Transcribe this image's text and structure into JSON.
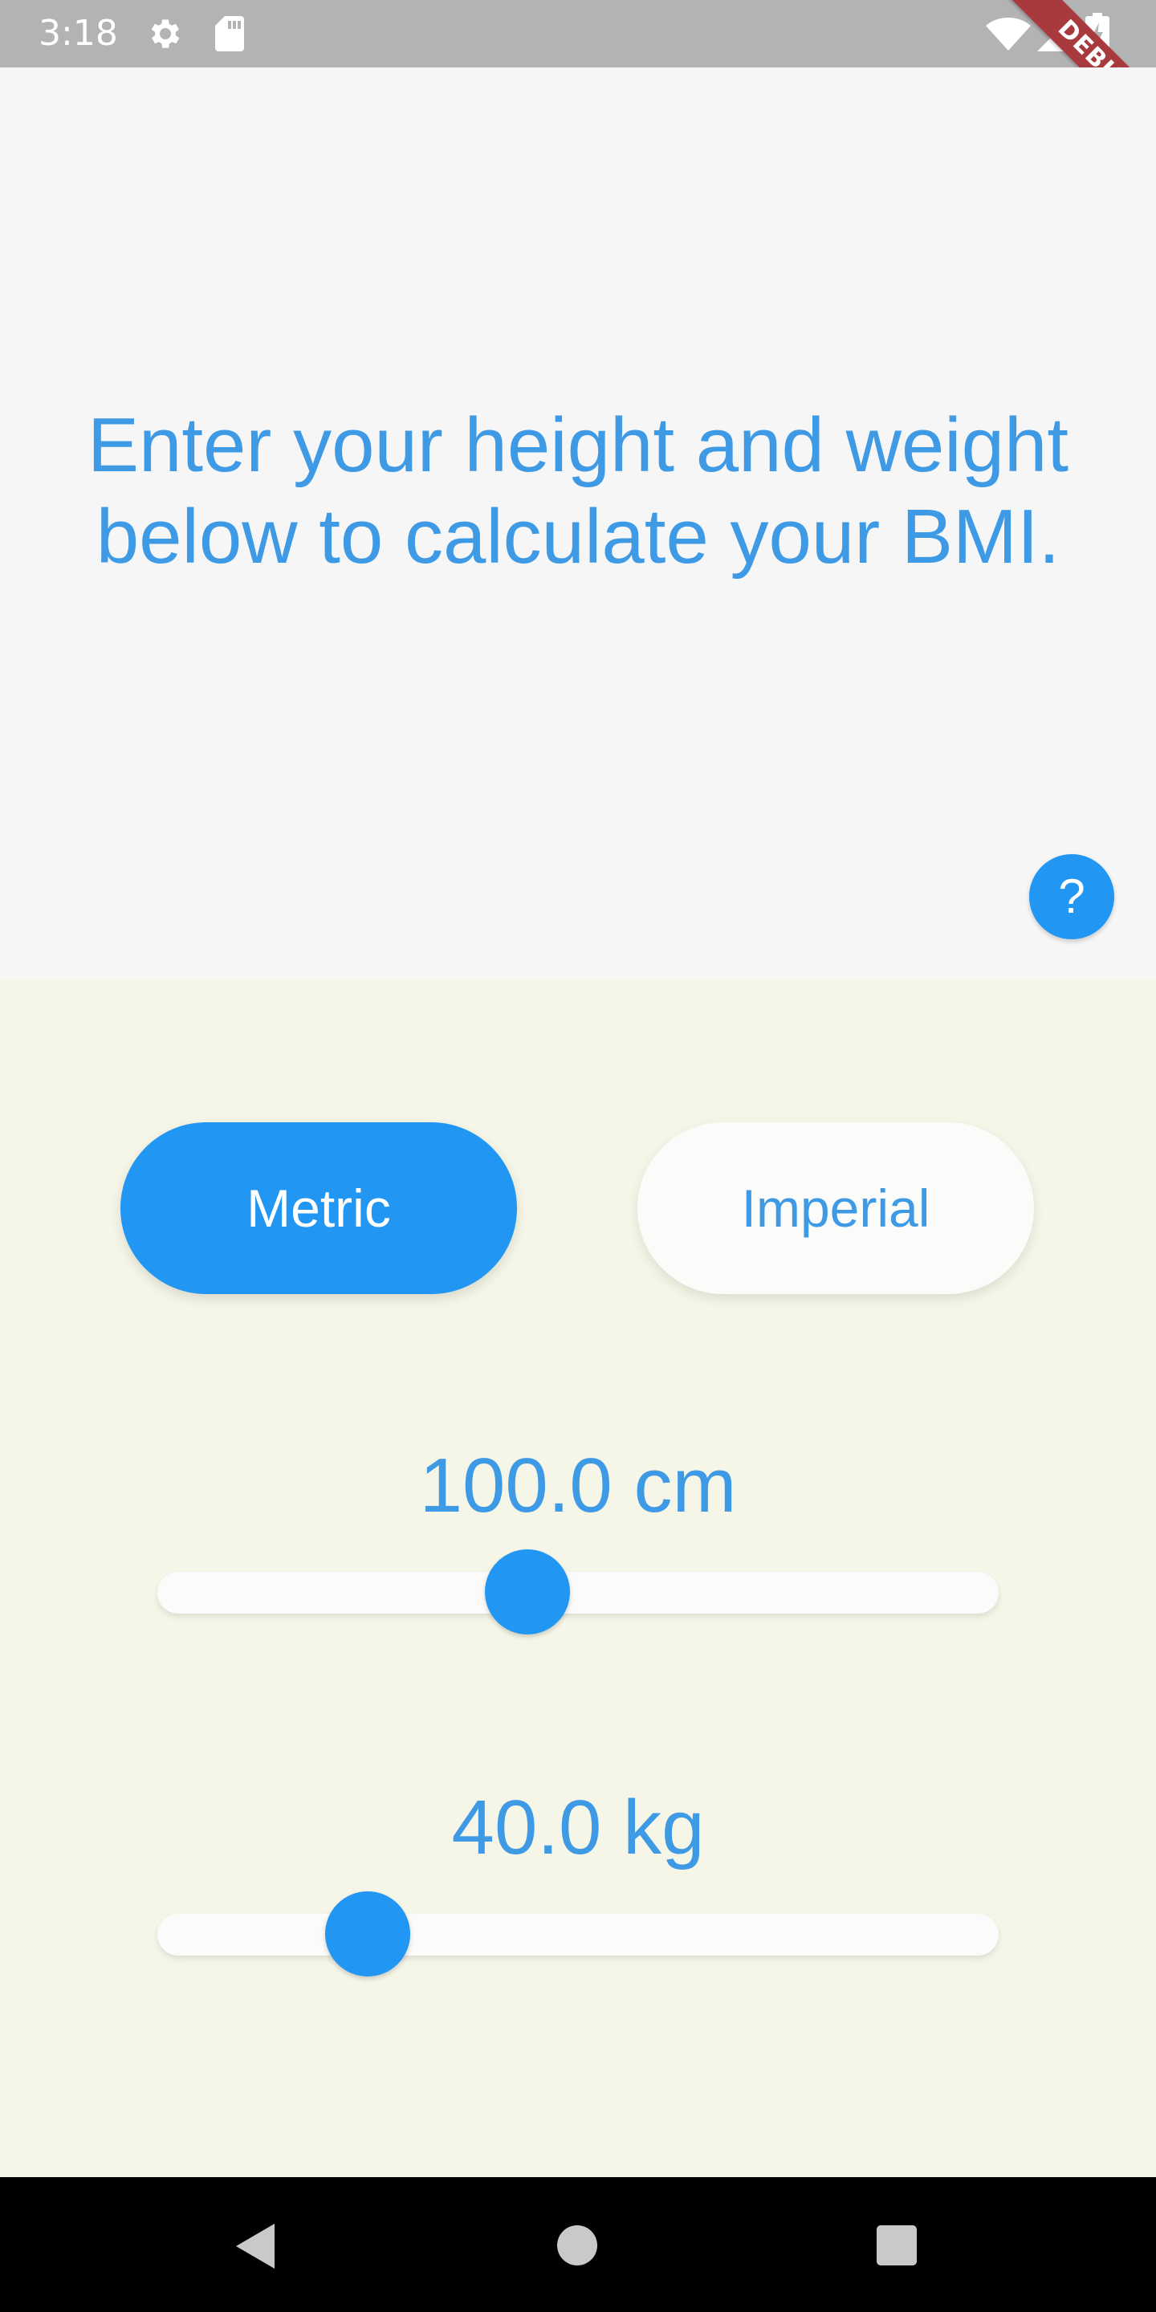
{
  "status_bar": {
    "time": "3:18",
    "icons": [
      "gear-icon",
      "sd-card-icon",
      "wifi-icon",
      "signal-icon",
      "battery-charging-icon"
    ]
  },
  "debug_banner": {
    "label": "DEBUG",
    "color": "#a8393c"
  },
  "intro": {
    "text": "Enter your height and weight below to calculate your BMI."
  },
  "help_button": {
    "label": "?",
    "icon": "help-icon"
  },
  "units": {
    "metric_label": "Metric",
    "imperial_label": "Imperial",
    "selected": "Metric"
  },
  "height": {
    "label": "100.0 cm",
    "slider_fraction": 0.44
  },
  "weight": {
    "label": "40.0 kg",
    "slider_fraction": 0.25
  },
  "nav_bar": {
    "icons": [
      "back-icon",
      "home-icon",
      "recents-icon"
    ]
  },
  "colors": {
    "accent": "#2196f3",
    "text_accent": "#3f9ae6",
    "top_background": "#f6f6f6",
    "bottom_background": "#f6f6e8",
    "status_bar": "#b3b3b3",
    "nav_bar": "#000000"
  }
}
